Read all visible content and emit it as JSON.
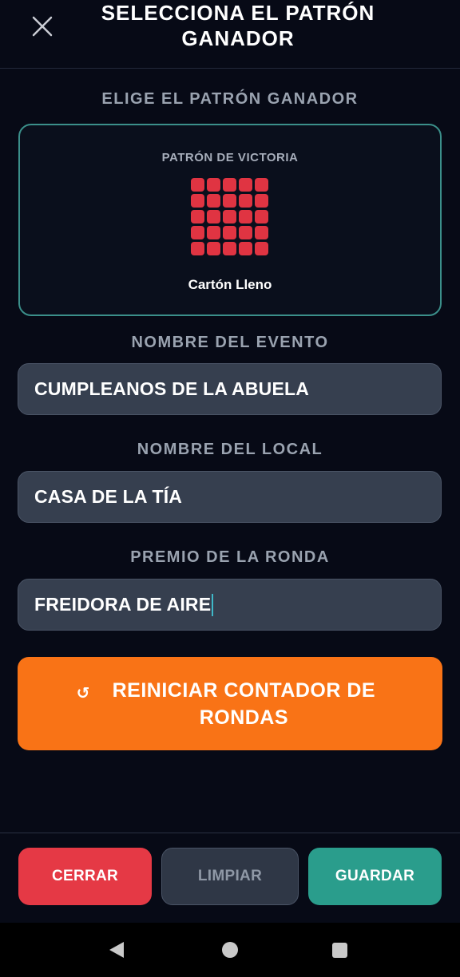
{
  "header": {
    "title": "SELECCIONA EL PATRÓN GANADOR",
    "close_icon": "close-icon"
  },
  "pattern": {
    "section_label": "ELIGE EL PATRÓN GANADOR",
    "card_label": "PATRÓN DE VICTORIA",
    "pattern_name": "Cartón Lleno",
    "grid_rows": 5,
    "grid_cols": 5,
    "cell_color": "#e03442",
    "border_color": "#3b8f8a"
  },
  "event": {
    "label": "NOMBRE DEL EVENTO",
    "value": "CUMPLEANOS DE LA ABUELA"
  },
  "venue": {
    "label": "NOMBRE DEL LOCAL",
    "value": "CASA DE LA TÍA"
  },
  "prize": {
    "label": "PREMIO DE LA RONDA",
    "value": "FREIDORA DE AIRE"
  },
  "reset": {
    "icon": "↺",
    "label": "REINICIAR CONTADOR DE RONDAS",
    "color": "#f97316"
  },
  "footer": {
    "close_label": "CERRAR",
    "clear_label": "LIMPIAR",
    "save_label": "GUARDAR",
    "close_color": "#e53945",
    "save_color": "#2a9d8c"
  },
  "nav_bar": {
    "back_icon": "back-icon",
    "home_icon": "home-icon",
    "recents_icon": "recents-icon"
  }
}
